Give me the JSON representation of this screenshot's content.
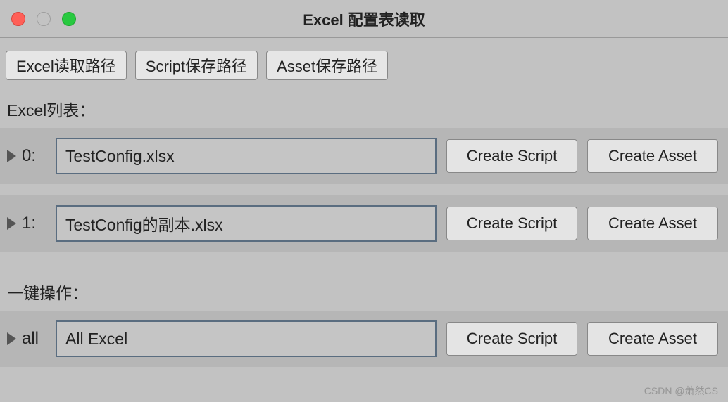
{
  "window": {
    "title": "Excel 配置表读取"
  },
  "topButtons": {
    "excelPath": "Excel读取路径",
    "scriptPath": "Script保存路径",
    "assetPath": "Asset保存路径"
  },
  "sections": {
    "excelList": "Excel列表：",
    "batch": "一键操作："
  },
  "rows": [
    {
      "label": "0:",
      "filename": "TestConfig.xlsx",
      "createScript": "Create Script",
      "createAsset": "Create Asset"
    },
    {
      "label": "1:",
      "filename": "TestConfig的副本.xlsx",
      "createScript": "Create Script",
      "createAsset": "Create Asset"
    }
  ],
  "batchRow": {
    "label": "all",
    "filename": "All Excel",
    "createScript": "Create Script",
    "createAsset": "Create Asset"
  },
  "watermark": "CSDN @萧然CS"
}
